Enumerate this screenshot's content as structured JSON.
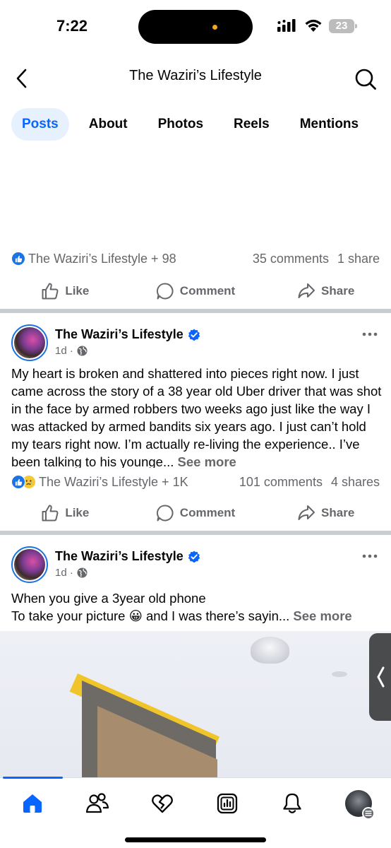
{
  "status_bar": {
    "time": "7:22",
    "battery": "23",
    "icons": [
      "cellular-signal-icon",
      "wifi-icon",
      "battery-icon"
    ]
  },
  "header": {
    "title": "The Waziri’s Lifestyle",
    "back_icon": "chevron-left-icon",
    "search_icon": "search-icon"
  },
  "tabs": [
    {
      "label": "Posts",
      "active": true
    },
    {
      "label": "About",
      "active": false
    },
    {
      "label": "Photos",
      "active": false
    },
    {
      "label": "Reels",
      "active": false
    },
    {
      "label": "Mentions",
      "active": false
    }
  ],
  "actions": {
    "like": "Like",
    "comment": "Comment",
    "share": "Share"
  },
  "posts": [
    {
      "reactions_text": "The Waziri’s Lifestyle + 98",
      "comments": "35 comments",
      "shares": "1 share"
    },
    {
      "author": "The Waziri’s Lifestyle",
      "time": "1d ·",
      "text": "My heart is broken and shattered into pieces right now. I just came across the story of a 38 year old Uber driver that was shot in the face by armed robbers two weeks ago just like the way I was attacked by armed bandits six years ago. I just can’t hold my tears right now. I’m actually re-living the experience.. I’ve been talking to his younge...",
      "see_more": "See more",
      "reactions_text": "The Waziri’s Lifestyle + 1K",
      "comments": "101 comments",
      "shares": "4 shares"
    },
    {
      "author": "The Waziri’s Lifestyle",
      "time": "1d ·",
      "text_line1": "When you give a 3year old phone",
      "text_line2": "To take your picture 😀 and I was there’s sayin...",
      "see_more": "See more"
    }
  ],
  "bottom_nav": [
    {
      "name": "home",
      "icon": "home-icon",
      "active": true
    },
    {
      "name": "friends",
      "icon": "friends-icon",
      "active": false
    },
    {
      "name": "dating",
      "icon": "heart-icon",
      "active": false
    },
    {
      "name": "dashboard",
      "icon": "dashboard-icon",
      "active": false
    },
    {
      "name": "notifications",
      "icon": "bell-icon",
      "active": false
    },
    {
      "name": "profile",
      "icon": "profile-avatar",
      "active": false
    }
  ],
  "colors": {
    "accent": "#0866ff",
    "secondary_text": "#65676b",
    "verified": "#0866ff",
    "divider": "#c9ccd1"
  }
}
